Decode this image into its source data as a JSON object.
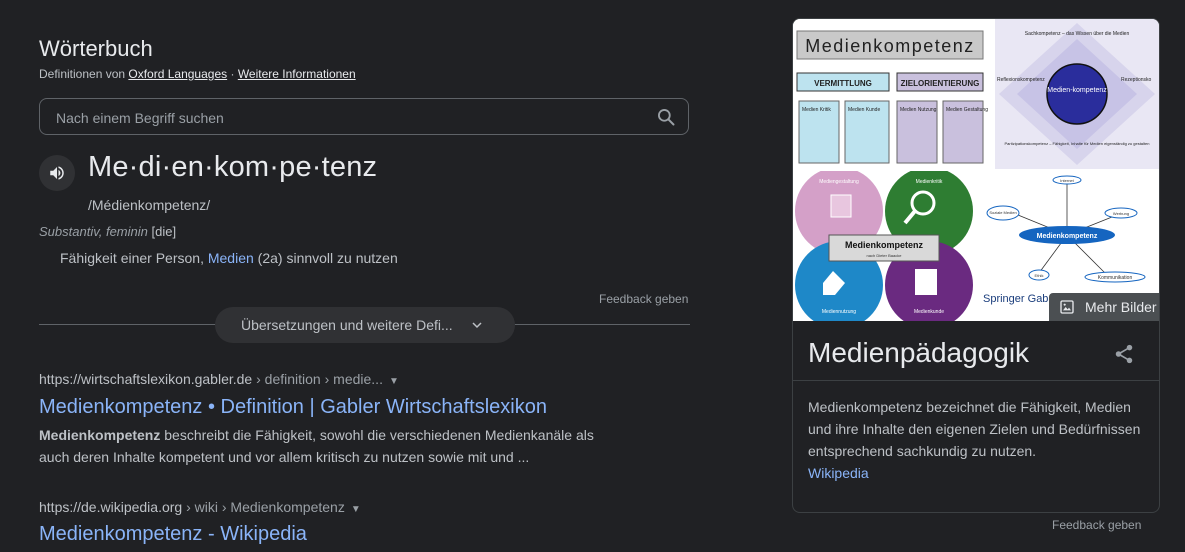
{
  "dictionary": {
    "title": "Wörterbuch",
    "source_prefix": "Definitionen von ",
    "source_name": "Oxford Languages",
    "source_sep": " · ",
    "more_info": "Weitere Informationen",
    "search_placeholder": "Nach einem Begriff suchen",
    "headword": "Me·di·en·kom·pe·tenz",
    "phonetic": "/Médienkompetenz/",
    "part_of_speech": "Substantiv, feminin",
    "article": "[die]",
    "definition_before": "Fähigkeit einer Person, ",
    "definition_link": "Medien",
    "definition_after": " (2a) sinnvoll zu nutzen",
    "feedback": "Feedback geben",
    "translations_button": "Übersetzungen und weitere Defi..."
  },
  "results": [
    {
      "url_domain": "https://wirtschaftslexikon.gabler.de",
      "url_path": " › definition › medie...",
      "title": "Medienkompetenz • Definition | Gabler Wirtschaftslexikon",
      "snippet_bold": "Medienkompetenz",
      "snippet_line1": " beschreibt die Fähigkeit, sowohl die verschiedenen Medienkanäle als",
      "snippet_line2": "auch deren Inhalte kompetent und vor allem kritisch zu nutzen sowie mit und ..."
    },
    {
      "url_domain": "https://de.wikipedia.org",
      "url_path": " › wiki › Medienkompetenz",
      "title": "Medienkompetenz - Wikipedia"
    }
  ],
  "knowledge_panel": {
    "heading": "Medienpädagogik",
    "description": "Medienkompetenz bezeichnet die Fähigkeit, Medien und ihre Inhalte den eigenen Zielen und Bedürfnissen entsprechend sachkundig zu nutzen.",
    "source_link": "Wikipedia",
    "more_images": "Mehr Bilder",
    "feedback": "Feedback geben",
    "img1": {
      "title": "Medienkompetenz",
      "col1": "VERMITTLUNG",
      "col2": "ZIELORIENTIERUNG",
      "box1": "Medien Kritik",
      "box2": "Medien Kunde",
      "box3": "Medien Nutzung",
      "box4": "Medien Gestaltung"
    },
    "img2": {
      "center": "Medien-kompetenz",
      "top": "Sachkompetenz – das Wissen über die Medien",
      "left": "Reflexionskompetenz",
      "right": "Rezeptionsko",
      "bottom": "Partizipationskompetenz – Fähigkeit, Inhalte für Medien eigenständig zu gestalten"
    },
    "img3": {
      "center": "Medienkompetenz",
      "sub": "nach Dieter Baacke",
      "q1": "Mediengestaltung",
      "q2": "Medienkritik",
      "q3": "Mediennutzung",
      "q4": "Medienkunde"
    },
    "img4": {
      "center": "Medienkompetenz",
      "n1": "Internet",
      "n2": "Soziale Medien",
      "n3": "Werbung",
      "n4": "Ethik",
      "n5": "Kommunikation",
      "publisher": "Springer Gab"
    }
  },
  "colors": {
    "background": "#202124",
    "link": "#8ab4f8",
    "text": "#bdc1c6",
    "heading": "#e8eaed"
  }
}
